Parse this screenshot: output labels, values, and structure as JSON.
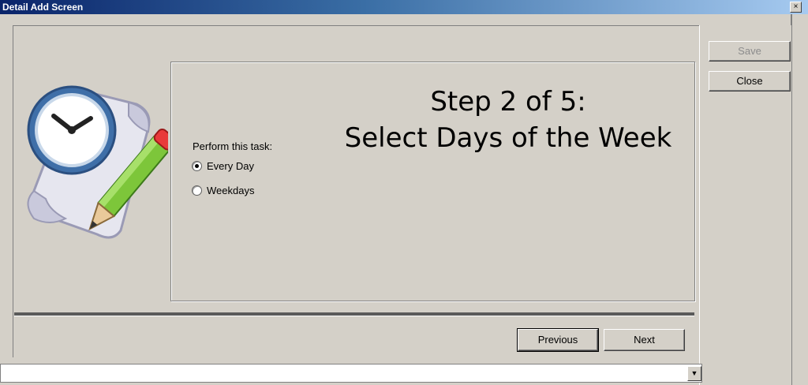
{
  "window": {
    "title": "Detail Add Screen",
    "close_glyph": "×"
  },
  "wizard": {
    "step_line1": "Step 2 of 5:",
    "step_line2": "Select Days of the Week",
    "perform_label": "Perform this task:",
    "options": [
      {
        "label": "Every Day",
        "checked": true
      },
      {
        "label": "Weekdays",
        "checked": false
      }
    ],
    "previous_label": "Previous",
    "next_label": "Next"
  },
  "side": {
    "save_label": "Save",
    "save_enabled": false,
    "close_label": "Close"
  },
  "status_combo": {
    "value": "",
    "arrow_glyph": "▼"
  },
  "icons": {
    "wizard": "scheduled-task-clock-pencil-icon"
  }
}
